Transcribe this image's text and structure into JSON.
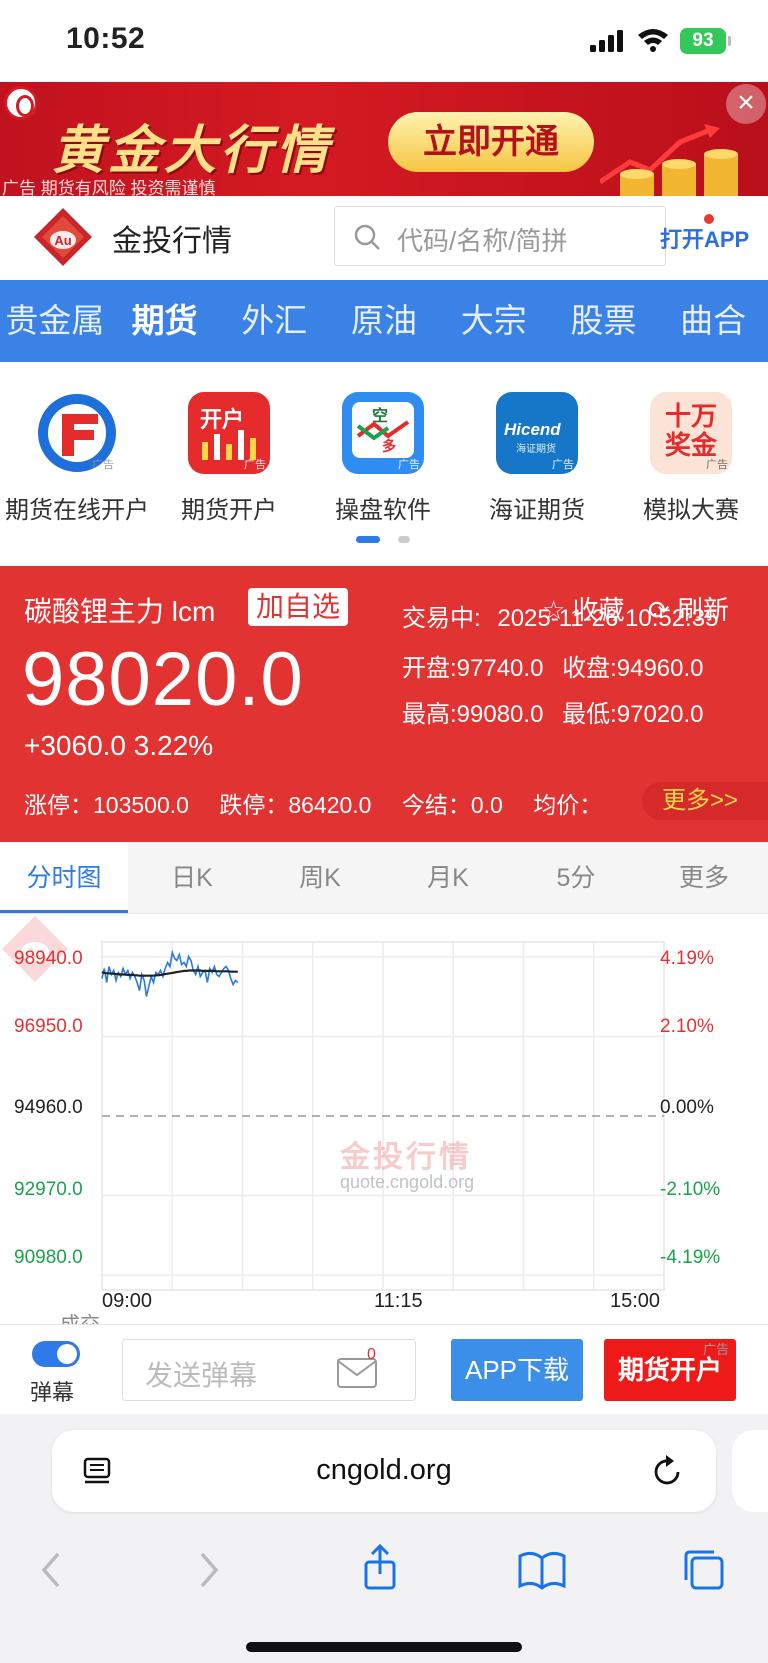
{
  "status_bar": {
    "time": "10:52",
    "battery": "93"
  },
  "banner": {
    "headline": "黄金大行情",
    "cta": "立即开通",
    "ad_line": "广告 期货有风险 投资需谨慎"
  },
  "header": {
    "brand": "金投行情",
    "search_placeholder": "代码/名称/简拼",
    "open_app": "打开APP"
  },
  "nav": {
    "items": [
      "贵金属",
      "期货",
      "外汇",
      "原油",
      "大宗",
      "股票",
      "曲合"
    ],
    "active_index": 1
  },
  "apps": [
    {
      "label": "期货在线开户",
      "icon": "futures-online-icon",
      "color": "#1e6fd9"
    },
    {
      "label": "期货开户",
      "icon": "futures-open-icon",
      "color": "#e52b2b"
    },
    {
      "label": "操盘软件",
      "icon": "trading-software-icon",
      "color": "#2f8cf0"
    },
    {
      "label": "海证期货",
      "icon": "hicend-icon",
      "color": "#1677c8"
    },
    {
      "label": "模拟大赛",
      "icon": "contest-icon",
      "color": "#f6d9c9"
    }
  ],
  "app_icon_text": {
    "open": "开户",
    "kong": "空",
    "duo": "多",
    "hicend": "Hicend",
    "hicend_sub": "海证期货",
    "contest": "十万奖金",
    "ad": "广告"
  },
  "quote": {
    "name": "碳酸锂主力 lcm",
    "add_watch": "加自选",
    "favorite": "收藏",
    "refresh": "刷新",
    "price": "98020.0",
    "change": "+3060.0 3.22%",
    "status": "交易中:",
    "datetime": "2025-11-26 10:52:35",
    "open": "开盘:97740.0",
    "close": "收盘:94960.0",
    "high": "最高:99080.0",
    "low": "最低:97020.0",
    "limit_up": "涨停：103500.0",
    "limit_down": "跌停：86420.0",
    "settle": "今结：0.0",
    "avg": "均价：",
    "more": "更多>>"
  },
  "tabs": {
    "items": [
      "分时图",
      "日K",
      "周K",
      "月K",
      "5分",
      "更多"
    ],
    "active_index": 0
  },
  "chart_data": {
    "type": "line",
    "y_left_labels": [
      "98940.0",
      "96950.0",
      "94960.0",
      "92970.0",
      "90980.0"
    ],
    "y_right_labels": [
      "4.19%",
      "2.10%",
      "0.00%",
      "-2.10%",
      "-4.19%"
    ],
    "x_labels": [
      "09:00",
      "11:15",
      "15:00"
    ],
    "ylim": [
      90980.0,
      98940.0
    ],
    "reference": 94960.0,
    "grid": true,
    "watermark": "金投行情",
    "watermark_url": "quote.cngold.org",
    "series": [
      {
        "values": [
          98400,
          98650,
          98300,
          98700,
          98500,
          98600,
          98350,
          98550,
          98450,
          98650,
          98500,
          98600,
          98400,
          98550,
          98450,
          98300,
          98100,
          98500,
          98350,
          97950,
          98200,
          98450,
          98300,
          98550,
          98500,
          98600,
          98450,
          98650,
          98800,
          98700,
          99050,
          98900,
          98850,
          99000,
          98750,
          98800,
          98700,
          98950,
          98850,
          98600,
          98500,
          98700,
          98450,
          98550,
          98600,
          98300,
          98650,
          98550,
          98700,
          98500,
          98450,
          98550,
          98650,
          98700,
          98600,
          98400,
          98250,
          98350,
          98300
        ],
        "color": "#2b7bd6"
      },
      {
        "values": [
          98560,
          98540,
          98530,
          98530,
          98520,
          98520,
          98510,
          98510,
          98500,
          98500,
          98500,
          98490,
          98490,
          98490,
          98480,
          98480,
          98470,
          98470,
          98470,
          98470,
          98470,
          98470,
          98470,
          98480,
          98480,
          98490,
          98500,
          98510,
          98520,
          98530,
          98540,
          98550,
          98560,
          98570,
          98580,
          98590,
          98590,
          98600,
          98600,
          98600,
          98600,
          98600,
          98600,
          98590,
          98590,
          98590,
          98590,
          98590,
          98590,
          98580,
          98580,
          98580,
          98580,
          98580,
          98580,
          98570,
          98570,
          98570,
          98570
        ],
        "color": "#222222"
      }
    ],
    "cut_label": "成交"
  },
  "toolbar": {
    "danmu_label": "弹幕",
    "danmu_placeholder": "发送弹幕",
    "msg_count": "0",
    "app_download": "APP下载",
    "open_account": "期货开户",
    "ad": "广告"
  },
  "safari": {
    "url": "cngold.org"
  }
}
